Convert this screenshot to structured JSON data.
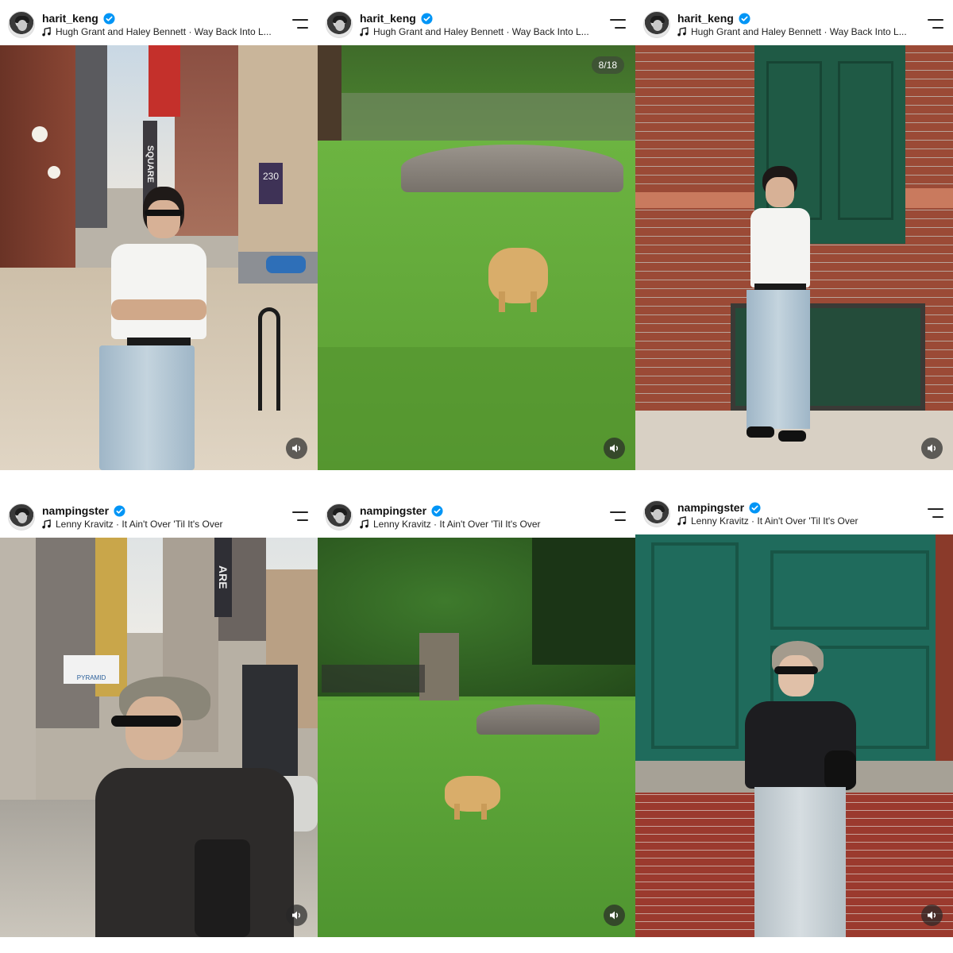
{
  "posts": [
    {
      "username": "harit_keng",
      "track": "Hugh Grant and Haley Bennett · Way Back Into L...",
      "counter": ""
    },
    {
      "username": "harit_keng",
      "track": "Hugh Grant and Haley Bennett · Way Back Into L...",
      "counter": "8/18"
    },
    {
      "username": "harit_keng",
      "track": "Hugh Grant and Haley Bennett · Way Back Into L...",
      "counter": ""
    },
    {
      "username": "nampingster",
      "track": "Lenny Kravitz · It Ain't Over 'Til It's Over",
      "counter": ""
    },
    {
      "username": "nampingster",
      "track": "Lenny Kravitz · It Ain't Over 'Til It's Over",
      "counter": ""
    },
    {
      "username": "nampingster",
      "track": "Lenny Kravitz · It Ain't Over 'Til It's Over",
      "counter": ""
    }
  ],
  "photo_text": {
    "square_sign": "SQUARE",
    "building_number": "230",
    "are_sign": "ARE",
    "pyramid_sign": "PYRAMID"
  },
  "icons": {
    "verified": "verified-badge-icon",
    "music": "music-note-icon",
    "menu": "menu-icon",
    "sound": "speaker-icon"
  },
  "colors": {
    "verified_blue": "#0095f6",
    "grass": "#5fa83a",
    "brick": "#9b4a36",
    "door_green": "#1f5a45"
  }
}
